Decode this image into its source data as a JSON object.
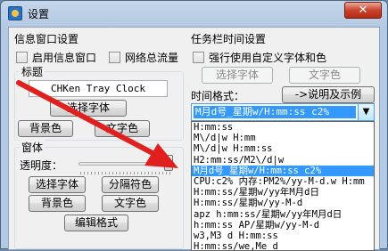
{
  "window": {
    "title": "设置",
    "close_symbol": "✕"
  },
  "info_window": {
    "group_label": "信息窗口设置",
    "enable_label": "启用信息窗口",
    "network_label": "网络总流量",
    "title_group_label": "标题",
    "title_value": "CHKen Tray Clock",
    "select_font_button": "选择字体",
    "bg_color_button": "背景色",
    "text_color_button": "文字色"
  },
  "form_window": {
    "group_label": "窗体",
    "transparency_label": "透明度：",
    "select_font_button": "选择字体",
    "separator_button": "分隔符色",
    "bg_color_button": "背景色",
    "text_color_button": "文字色",
    "edit_format_button": "编辑格式"
  },
  "taskbar": {
    "group_label": "任务栏时间设置",
    "force_custom_label": "强行使用自定义字体和色",
    "select_font_button": "选择字体",
    "text_color_button": "文字色",
    "time_format_label": "时间格式：",
    "help_button": "->说明及示例",
    "selected_format": "M月d号_星期w/H:mm:ss c2%",
    "format_options": [
      "H:mm:ss",
      "M\\/d|w H:mm",
      "M\\/d|w H:mm:ss",
      "H2:mm:ss/M2\\/d|w",
      "M月d号_星期w/H:mm:ss c2%",
      "CPU:c2% 内存:PM2%/yy-M-d.w H:mm",
      "H:mm:ss/星期w/yy年M月d日",
      "H:mm:ss/星期w/yy-M-d",
      "apz h:mm:ss/星期w/yy年M月d日",
      "h:mm:ss AP/星期w/yy-M-d",
      "w3,M3 d H:mm:ss",
      "H:mm:ss/we,Me d"
    ],
    "selected_index": 4
  },
  "colors": {
    "arrow": "#e0201f",
    "selection": "#3399ff"
  },
  "icons": {
    "app": "app-icon",
    "close": "close-icon",
    "dropdown": "chevron-down-icon",
    "annotation": "red-arrow"
  }
}
